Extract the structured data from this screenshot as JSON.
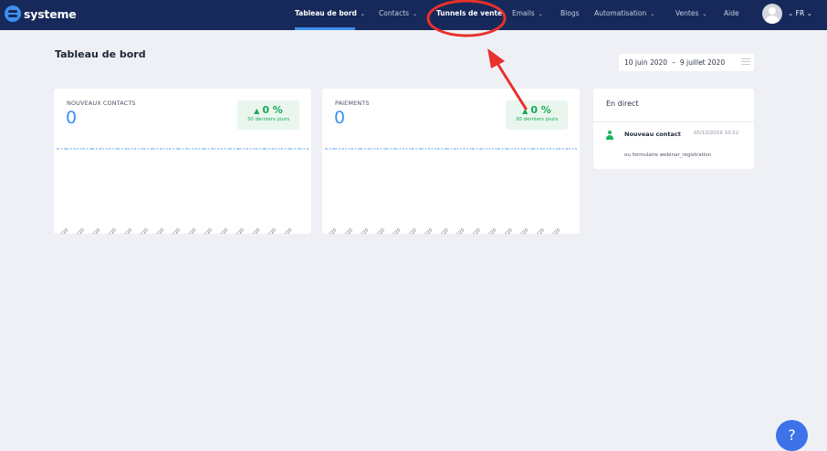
{
  "brand": {
    "name": "systeme"
  },
  "nav": {
    "items": [
      {
        "label": "Tableau de bord",
        "chevron": "⌄",
        "active": true
      },
      {
        "label": "Contacts",
        "chevron": "⌄"
      },
      {
        "label": "Tunnels de vente",
        "chevron": ""
      },
      {
        "label": "Emails",
        "chevron": "⌄"
      },
      {
        "label": "Blogs",
        "chevron": ""
      },
      {
        "label": "Automatisation",
        "chevron": "⌄"
      },
      {
        "label": "Ventes",
        "chevron": "⌄"
      },
      {
        "label": "Aide",
        "chevron": ""
      }
    ],
    "language": "⌄  FR  ⌄"
  },
  "page": {
    "title": "Tableau de bord",
    "date_start": "10 juin 2020",
    "date_sep": "–",
    "date_end": "9 juillet 2020"
  },
  "cards": [
    {
      "label": "NOUVEAUX CONTACTS",
      "value": "0",
      "badge_pct": "0 %",
      "badge_sub": "30 derniers jours",
      "x_labels": [
        "11 juin 2020",
        "13 juin 2020",
        "15 juin 2020",
        "17 juin 2020",
        "19 juin 2020",
        "21 juin 2020",
        "23 juin 2020",
        "25 juin 2020",
        "27 juin 2020",
        "29 juin 2020",
        "1 juil. 2020",
        "3 juil. 2020",
        "5 juil. 2020",
        "7 juil. 2020",
        "9 juil. 2020"
      ]
    },
    {
      "label": "PAIEMENTS",
      "value": "0",
      "badge_pct": "0 %",
      "badge_sub": "30 derniers jours",
      "x_labels": [
        "11 juin 2020",
        "13 juin 2020",
        "15 juin 2020",
        "17 juin 2020",
        "19 juin 2020",
        "21 juin 2020",
        "23 juin 2020",
        "25 juin 2020",
        "27 juin 2020",
        "29 juin 2020",
        "1 juil. 2020",
        "3 juil. 2020",
        "5 juil. 2020",
        "7 juil. 2020",
        "9 juil. 2020"
      ]
    }
  ],
  "live": {
    "title": "En direct",
    "event_title": "Nouveau contact",
    "event_time": "05/10/2019 10:52",
    "event_desc": "ou formulaire webinar_registration"
  },
  "help": {
    "label": "?"
  },
  "colors": {
    "nav_bg": "#16295a",
    "accent": "#3d8ff0",
    "success": "#18a957",
    "annotation": "#e8312b"
  },
  "icons": [
    "systeme-logo-icon",
    "chevron-down-icon",
    "avatar-icon",
    "calendar-icon",
    "triangle-up-icon",
    "person-icon",
    "help-icon"
  ]
}
